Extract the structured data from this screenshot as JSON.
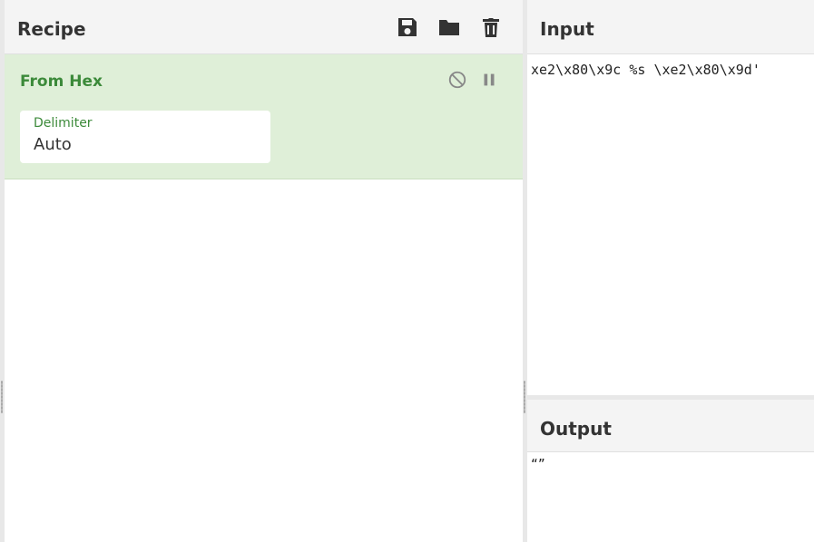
{
  "recipe": {
    "title": "Recipe",
    "icons": [
      "save-icon",
      "folder-icon",
      "trash-icon"
    ],
    "operation": {
      "name": "From Hex",
      "delimiter_label": "Delimiter",
      "delimiter_value": "Auto"
    }
  },
  "input": {
    "title": "Input",
    "text": "xe2\\x80\\x9c %s \\xe2\\x80\\x9d'"
  },
  "output": {
    "title": "Output",
    "text": "“”"
  },
  "colors": {
    "accent_green": "#3c8a3a",
    "card_bg": "#dfefd8"
  }
}
